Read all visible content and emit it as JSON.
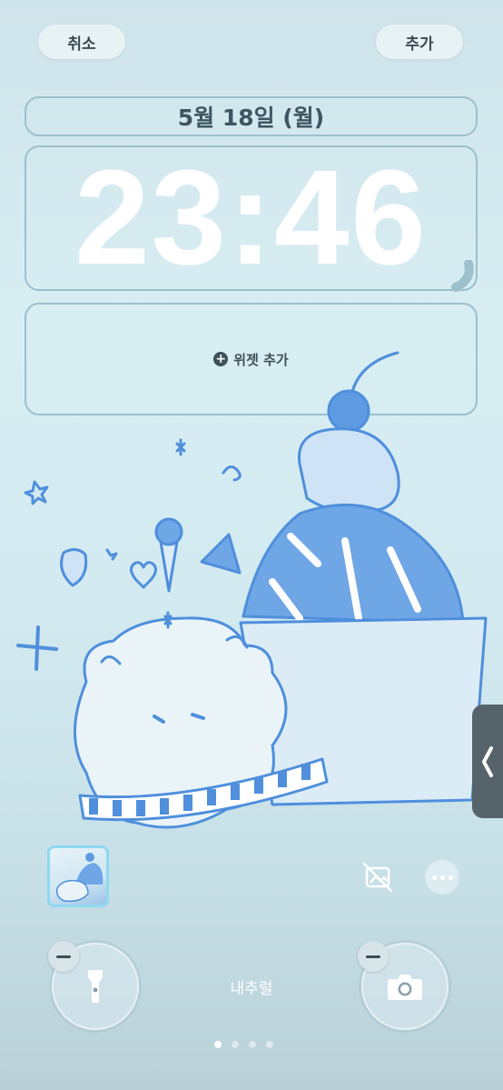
{
  "header": {
    "cancel_label": "취소",
    "add_label": "추가"
  },
  "lock": {
    "date": "5월 18일 (월)",
    "time": "23:46"
  },
  "widgets": {
    "add_label": "위젯 추가"
  },
  "wallpaper": {
    "caption": "내추럴"
  },
  "pager": {
    "count": 4,
    "active_index": 0
  },
  "colors": {
    "ink": "#4f8fdc",
    "frame": "#9cc0cd",
    "thumb_border": "#8fd8f2"
  },
  "icons": {
    "plus": "plus-circle-icon",
    "flashlight": "flashlight-icon",
    "camera": "camera-icon",
    "photo_off": "photo-shuffle-off-icon",
    "more": "ellipsis-icon",
    "chevron": "chevron-left-icon"
  }
}
